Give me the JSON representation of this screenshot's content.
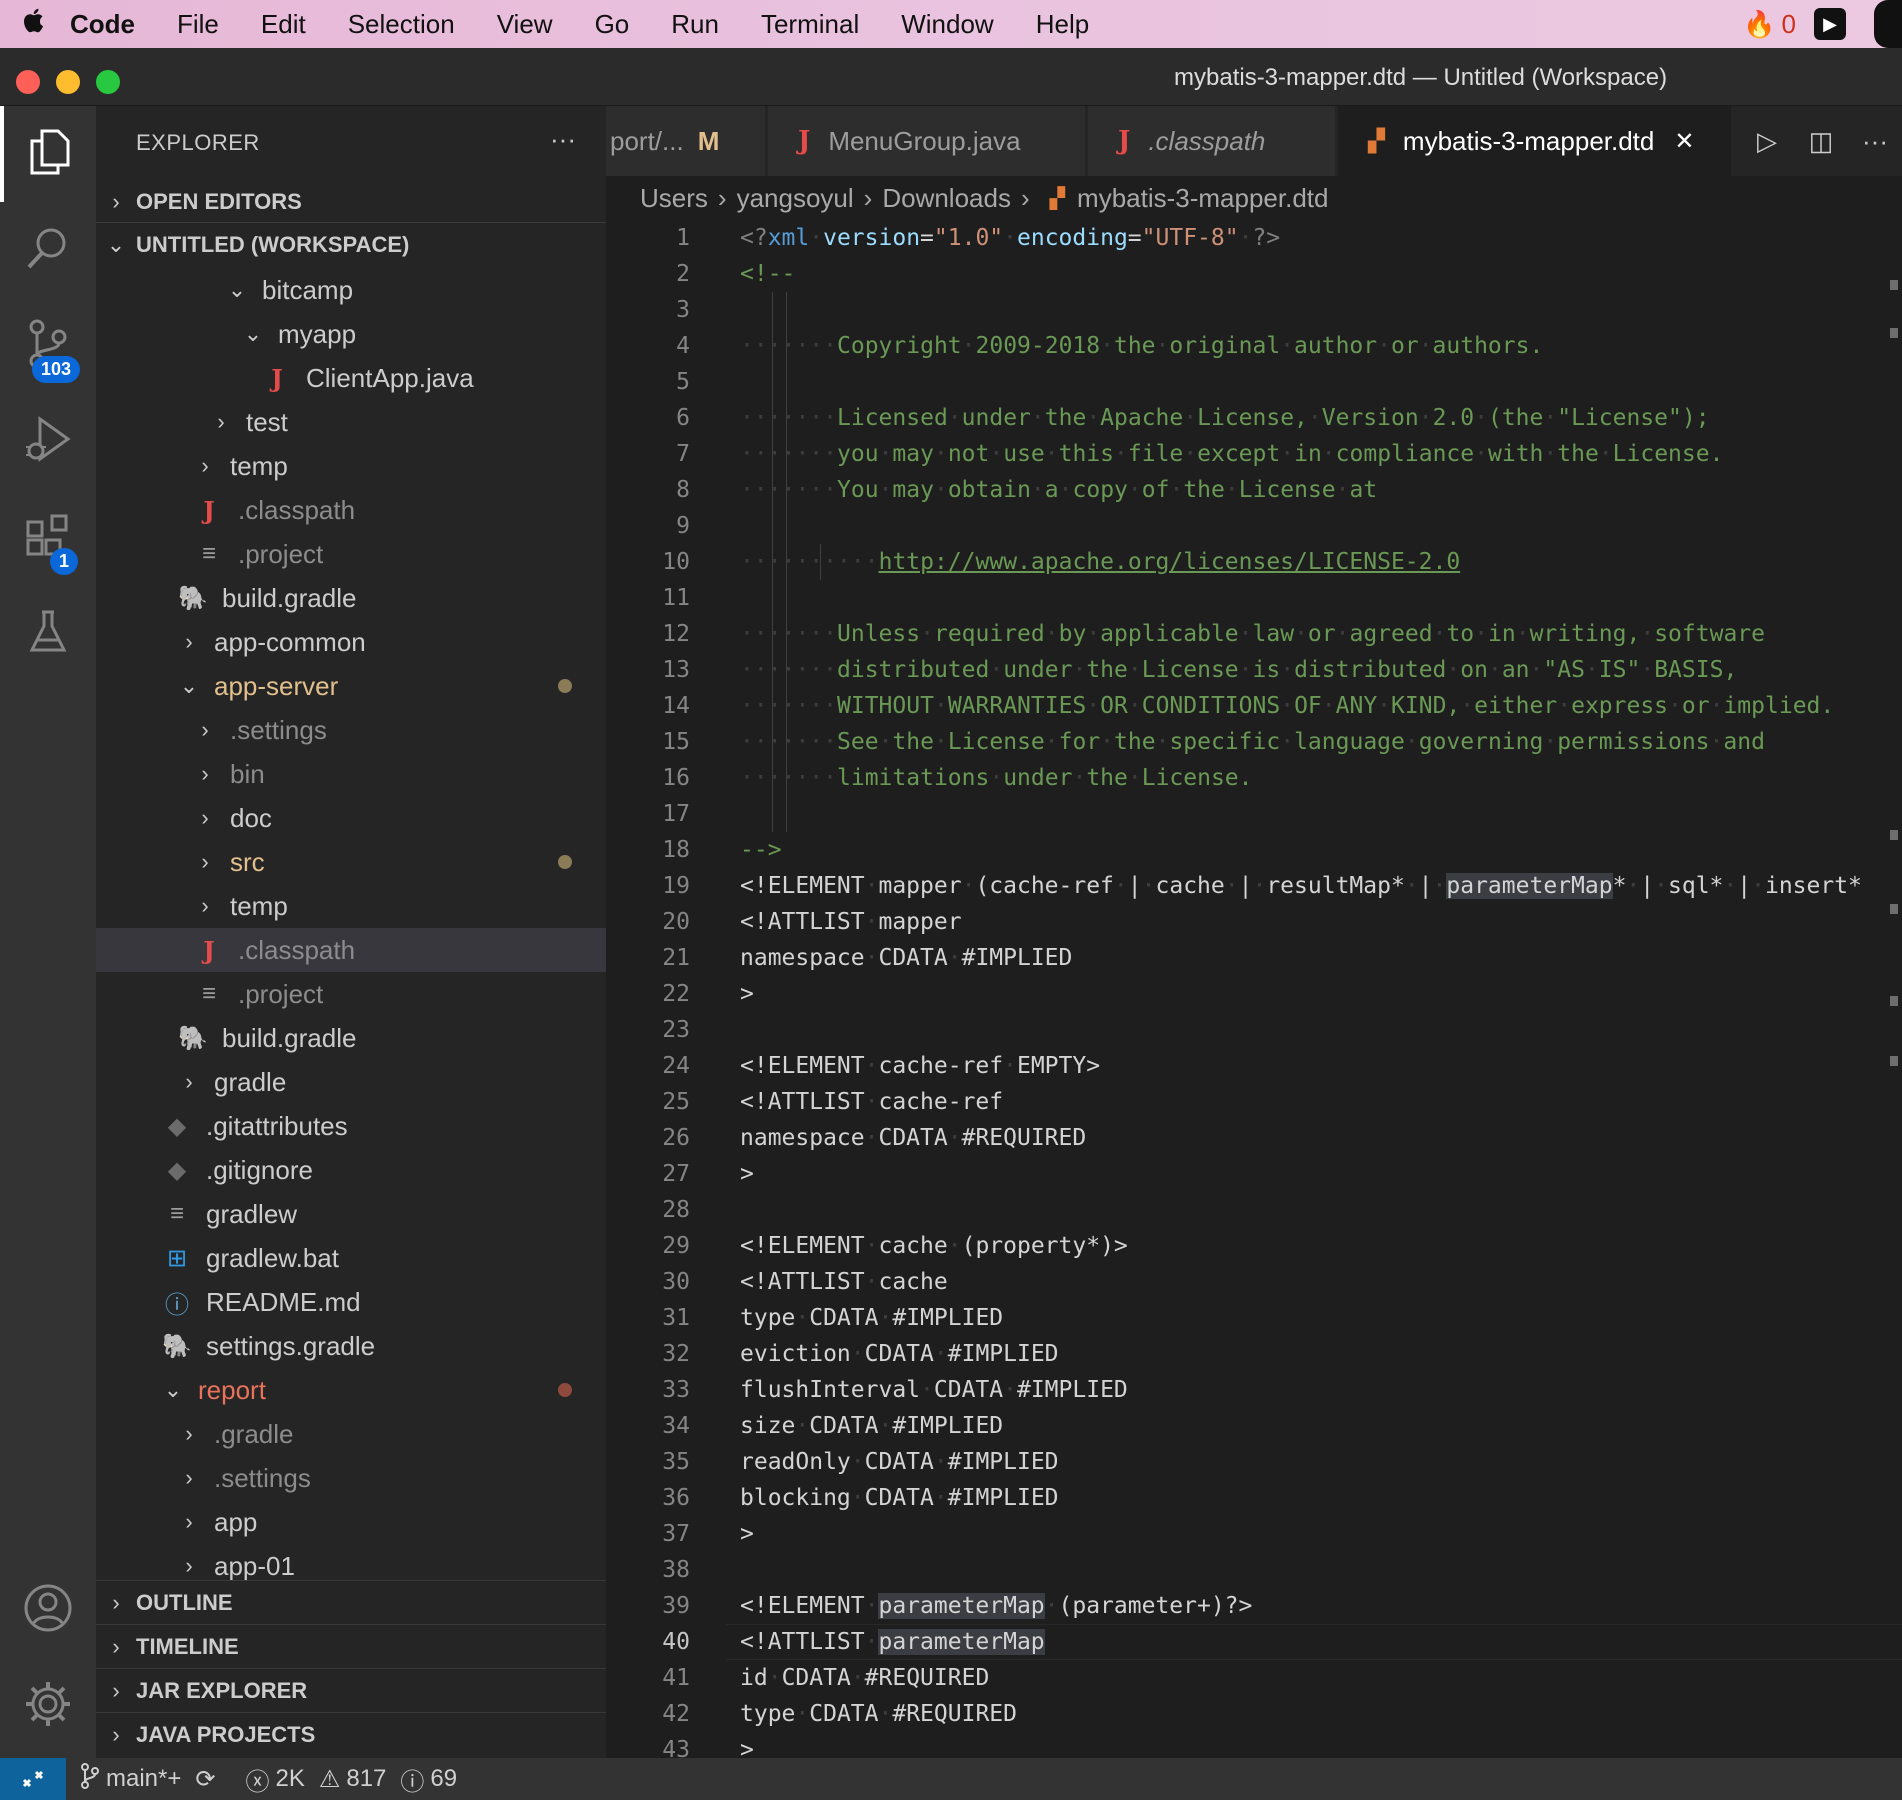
{
  "menubar": {
    "apple": "",
    "app": "Code",
    "items": [
      "File",
      "Edit",
      "Selection",
      "View",
      "Go",
      "Run",
      "Terminal",
      "Window",
      "Help"
    ],
    "fire_count": "0"
  },
  "window": {
    "title": "mybatis-3-mapper.dtd — Untitled (Workspace)"
  },
  "activity": {
    "scm_badge": "103",
    "extensions_badge": "1"
  },
  "sidebar": {
    "title": "EXPLORER",
    "more": "···",
    "open_editors": "OPEN EDITORS",
    "workspace": "UNTITLED (WORKSPACE)",
    "tree": [
      {
        "label": "bitcamp",
        "chev": "v",
        "icon": "",
        "color": "normal"
      },
      {
        "label": "myapp",
        "chev": "v",
        "icon": "",
        "color": "normal"
      },
      {
        "label": "ClientApp.java",
        "chev": "",
        "icon": "java",
        "color": "normal"
      },
      {
        "label": "test",
        "chev": ">",
        "icon": "",
        "color": "normal"
      },
      {
        "label": "temp",
        "chev": ">",
        "icon": "",
        "color": "normal"
      },
      {
        "label": ".classpath",
        "chev": "",
        "icon": "java",
        "color": "dim"
      },
      {
        "label": ".project",
        "chev": "",
        "icon": "lines",
        "color": "dim"
      },
      {
        "label": "build.gradle",
        "chev": "",
        "icon": "gradle",
        "color": "normal"
      },
      {
        "label": "app-common",
        "chev": ">",
        "icon": "",
        "color": "normal"
      },
      {
        "label": "app-server",
        "chev": "v",
        "icon": "",
        "color": "modified"
      },
      {
        "label": ".settings",
        "chev": ">",
        "icon": "",
        "color": "dim"
      },
      {
        "label": "bin",
        "chev": ">",
        "icon": "",
        "color": "dim"
      },
      {
        "label": "doc",
        "chev": ">",
        "icon": "",
        "color": "normal"
      },
      {
        "label": "src",
        "chev": ">",
        "icon": "",
        "color": "modified"
      },
      {
        "label": "temp",
        "chev": ">",
        "icon": "",
        "color": "normal"
      },
      {
        "label": ".classpath",
        "chev": "",
        "icon": "java",
        "color": "dim"
      },
      {
        "label": ".project",
        "chev": "",
        "icon": "lines",
        "color": "dim"
      },
      {
        "label": "build.gradle",
        "chev": "",
        "icon": "gradle",
        "color": "normal"
      },
      {
        "label": "gradle",
        "chev": ">",
        "icon": "",
        "color": "normal"
      },
      {
        "label": ".gitattributes",
        "chev": "",
        "icon": "git",
        "color": "normal"
      },
      {
        "label": ".gitignore",
        "chev": "",
        "icon": "git",
        "color": "normal"
      },
      {
        "label": "gradlew",
        "chev": "",
        "icon": "lines",
        "color": "normal"
      },
      {
        "label": "gradlew.bat",
        "chev": "",
        "icon": "windows",
        "color": "normal"
      },
      {
        "label": "README.md",
        "chev": "",
        "icon": "info",
        "color": "normal"
      },
      {
        "label": "settings.gradle",
        "chev": "",
        "icon": "gradle",
        "color": "normal"
      },
      {
        "label": "report",
        "chev": "v",
        "icon": "",
        "color": "deleted"
      },
      {
        "label": ".gradle",
        "chev": ">",
        "icon": "",
        "color": "dim"
      },
      {
        "label": ".settings",
        "chev": ">",
        "icon": "",
        "color": "dim"
      },
      {
        "label": "app",
        "chev": ">",
        "icon": "",
        "color": "normal"
      },
      {
        "label": "app-01",
        "chev": ">",
        "icon": "",
        "color": "normal"
      }
    ],
    "sections": [
      "OUTLINE",
      "TIMELINE",
      "JAR EXPLORER",
      "JAVA PROJECTS"
    ]
  },
  "tabs": [
    {
      "label": "port/...",
      "marker": "M",
      "icon": "",
      "italic": false
    },
    {
      "label": "MenuGroup.java",
      "marker": "",
      "icon": "java",
      "italic": false
    },
    {
      "label": ".classpath",
      "marker": "",
      "icon": "java",
      "italic": true
    },
    {
      "label": "mybatis-3-mapper.dtd",
      "marker": "",
      "icon": "rss",
      "italic": false
    }
  ],
  "tab_close": "✕",
  "breadcrumb": [
    "Users",
    "yangsoyul",
    "Downloads",
    "mybatis-3-mapper.dtd"
  ],
  "editor": {
    "current_line": 40,
    "lines": [
      "<?xml version=\"1.0\" encoding=\"UTF-8\" ?>",
      "<!--",
      "",
      "       Copyright 2009-2018 the original author or authors.",
      "",
      "       Licensed under the Apache License, Version 2.0 (the \"License\");",
      "       you may not use this file except in compliance with the License.",
      "       You may obtain a copy of the License at",
      "",
      "          http://www.apache.org/licenses/LICENSE-2.0",
      "",
      "       Unless required by applicable law or agreed to in writing, software",
      "       distributed under the License is distributed on an \"AS IS\" BASIS,",
      "       WITHOUT WARRANTIES OR CONDITIONS OF ANY KIND, either express or implied.",
      "       See the License for the specific language governing permissions and",
      "       limitations under the License.",
      "",
      "-->",
      "<!ELEMENT mapper (cache-ref | cache | resultMap* | parameterMap* | sql* | insert*",
      "<!ATTLIST mapper",
      "namespace CDATA #IMPLIED",
      ">",
      "",
      "<!ELEMENT cache-ref EMPTY>",
      "<!ATTLIST cache-ref",
      "namespace CDATA #REQUIRED",
      ">",
      "",
      "<!ELEMENT cache (property*)>",
      "<!ATTLIST cache",
      "type CDATA #IMPLIED",
      "eviction CDATA #IMPLIED",
      "flushInterval CDATA #IMPLIED",
      "size CDATA #IMPLIED",
      "readOnly CDATA #IMPLIED",
      "blocking CDATA #IMPLIED",
      ">",
      "",
      "<!ELEMENT parameterMap (parameter+)?>",
      "<!ATTLIST parameterMap",
      "id CDATA #REQUIRED",
      "type CDATA #REQUIRED",
      ">"
    ]
  },
  "statusbar": {
    "branch": "main*+",
    "errors": "2K",
    "warnings": "817",
    "infos": "69"
  }
}
